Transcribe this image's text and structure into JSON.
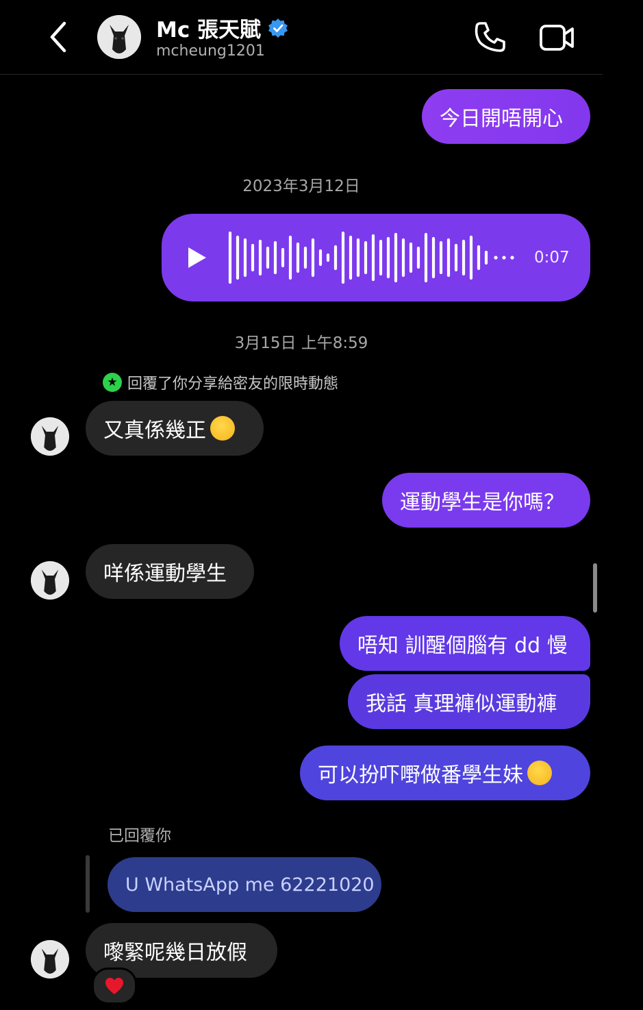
{
  "header": {
    "back_icon": "chevron-left-icon",
    "name": "Mc 張天賦",
    "username": "mcheung1201",
    "verified_color": "#3897f0",
    "call_icon": "phone-icon",
    "video_icon": "video-camera-icon"
  },
  "messages": {
    "m1": "今日開唔開心",
    "ts1": "2023年3月12日",
    "voice_duration": "0:07",
    "ts2": "3月15日 上午8:59",
    "reply_note": "回覆了你分享給密友的限時動態",
    "m2": "又真係幾正",
    "m3": "運動學生是你嗎？",
    "m4": "咩係運動學生",
    "m5": "唔知 訓醒個腦有 dd 慢",
    "m6": "我話 真理褲似運動褲",
    "m7": "可以扮吓嘢做番學生妹",
    "replied_label": "已回覆你",
    "quoted": "U WhatsApp me 62221020",
    "m8": "嚟緊呢幾日放假",
    "reaction_icon": "heart-icon"
  },
  "colors": {
    "outgoing": "#7c3aed",
    "incoming": "#262626",
    "quoted": "#2d3c8c"
  }
}
